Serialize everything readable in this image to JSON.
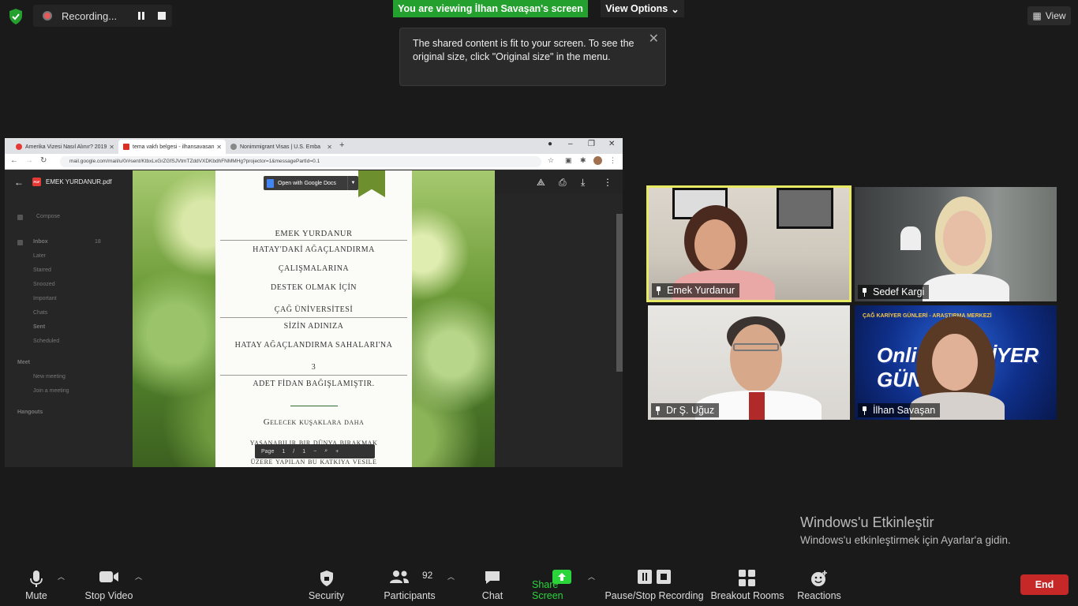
{
  "recording": {
    "label": "Recording..."
  },
  "banner": {
    "viewing": "You are viewing İlhan Savaşan's screen",
    "view_options": "View Options"
  },
  "tooltip": {
    "text": "The shared content is fit to your screen. To see the original size, click \"Original size\" in the menu."
  },
  "view_button": "View",
  "browser": {
    "tabs": [
      {
        "label": "Amerika Vizesi Nasıl Alınır? 2019"
      },
      {
        "label": "tema vakfı belgesi - ilhansavasan"
      },
      {
        "label": "Nonimmigrant Visas | U.S. Emba"
      }
    ],
    "url": "mail.google.com/mail/u/0/#sent/KtbxLxGrZGfSJVtmTZddVXDKbdhFNMMHg?projector=1&messagePartId=0.1"
  },
  "gmail": {
    "sidebar": [
      "Compose",
      "Inbox",
      "Later",
      "Starred",
      "Snoozed",
      "Important",
      "Chats",
      "Sent",
      "Scheduled"
    ],
    "meet_label": "Meet",
    "meet_items": [
      "New meeting",
      "Join a meeting"
    ],
    "hangouts_label": "Hangouts",
    "inbox_count": "18"
  },
  "pdf": {
    "filename": "EMEK YURDANUR.pdf",
    "open_with": "Open with Google Docs",
    "pager_label": "Page",
    "page_current": "1",
    "page_sep": "/",
    "page_total": "1",
    "certificate": {
      "name": "EMEK YURDANUR",
      "line1": "HATAY'DAKİ AĞAÇLANDIRMA",
      "line2": "ÇALIŞMALARINA",
      "line3": "DESTEK OLMAK İÇİN",
      "line4": "ÇAĞ ÜNİVERSİTESİ",
      "line5": "SİZİN ADINIZA",
      "line6": "HATAY AĞAÇLANDIRMA SAHALARI'NA",
      "count": "3",
      "line7": "ADET FİDAN BAĞIŞLAMIŞTIR.",
      "quote1": "Gelecek kuşaklara daha",
      "quote2": "yaşanabilir bir dünya bırakmak",
      "quote3": "üzere yapılan bu katkıya vesile"
    }
  },
  "participants": [
    {
      "name": "Emek Yurdanur"
    },
    {
      "name": "Sedef Kargi"
    },
    {
      "name": "Dr Ş. Uğuz"
    },
    {
      "name": "İlhan Savaşan"
    }
  ],
  "tile_banner": {
    "top_text": "ÇAĞ KARİYER GÜNLERİ - ARAŞTIRMA MERKEZİ",
    "big_text": "Online KARİYER GÜNLERİ"
  },
  "watermark": {
    "title": "Windows'u Etkinleştir",
    "subtitle": "Windows'u etkinleştirmek için Ayarlar'a gidin."
  },
  "toolbar": {
    "mute": "Mute",
    "stop_video": "Stop Video",
    "security": "Security",
    "participants": "Participants",
    "participants_count": "92",
    "chat": "Chat",
    "share_screen": "Share Screen",
    "pause_stop_recording": "Pause/Stop Recording",
    "breakout_rooms": "Breakout Rooms",
    "reactions": "Reactions",
    "end": "End"
  },
  "colors": {
    "share_green": "#2bd43b",
    "banner_green": "#23a02e",
    "end_red": "#c62828",
    "active_speaker": "#e9ea63"
  }
}
